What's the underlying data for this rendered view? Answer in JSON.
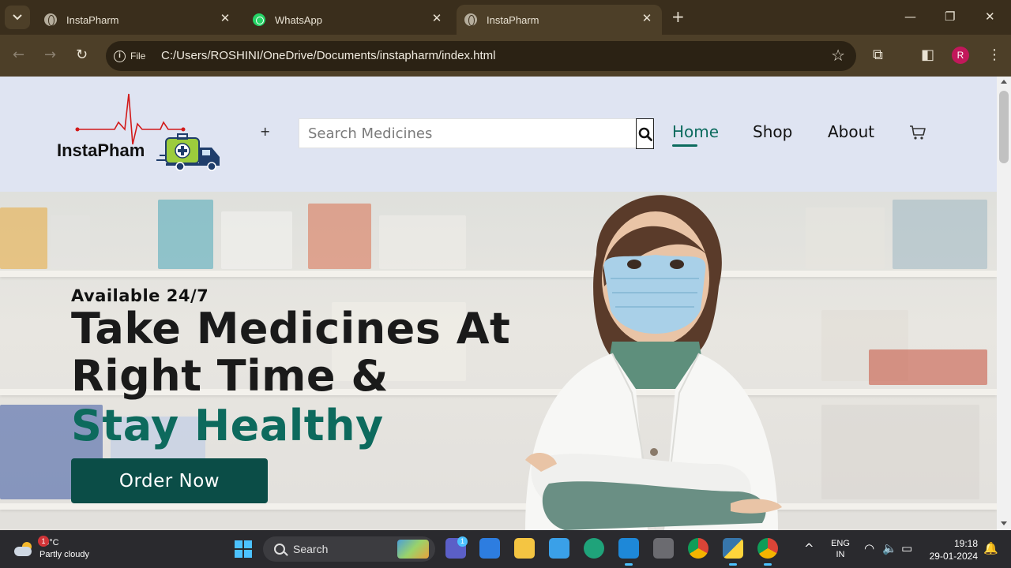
{
  "browser": {
    "tabs": [
      {
        "title": "InstaPharm",
        "icon": "globe-icon"
      },
      {
        "title": "WhatsApp",
        "icon": "whatsapp-icon"
      },
      {
        "title": "InstaPharm",
        "icon": "globe-icon"
      }
    ],
    "address_chip": "File",
    "url": "C:/Users/ROSHINI/OneDrive/Documents/instapharm/index.html",
    "profile_initial": "R"
  },
  "site": {
    "logo_text": "InstaPham",
    "plus": "+",
    "search_placeholder": "Search Medicines",
    "nav": [
      {
        "label": "Home",
        "active": true
      },
      {
        "label": "Shop",
        "active": false
      },
      {
        "label": "About",
        "active": false
      }
    ],
    "colors": {
      "accent": "#0c6b5e",
      "button": "#0b4d47",
      "header_bg": "#dfe4f2"
    }
  },
  "hero": {
    "eyebrow": "Available 24/7",
    "line1": "Take Medicines At",
    "line2": "Right Time &",
    "line3": "Stay Healthy",
    "cta": "Order Now"
  },
  "taskbar": {
    "weather_temp": "26°C",
    "weather_desc": "Partly cloudy",
    "weather_badge": "1",
    "search_label": "Search",
    "teams_badge": "1",
    "lang_top": "ENG",
    "lang_bottom": "IN",
    "time": "19:18",
    "date": "29-01-2024"
  }
}
